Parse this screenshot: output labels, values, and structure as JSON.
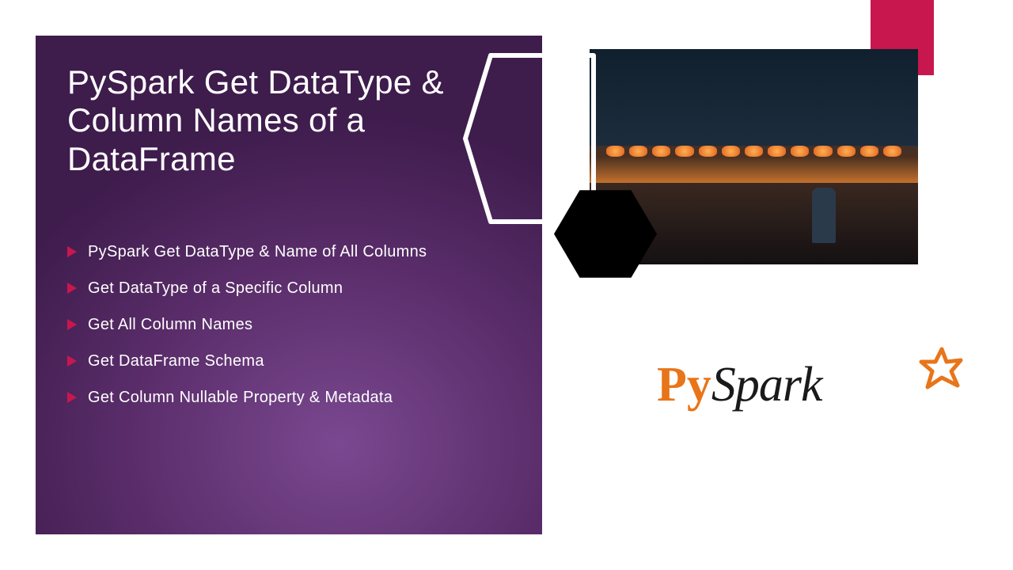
{
  "title": "PySpark Get DataType & Column Names of a DataFrame",
  "bullets": [
    "PySpark Get DataType & Name of All Columns",
    "Get DataType of a Specific Column",
    "Get All Column Names",
    "Get DataFrame Schema",
    "Get Column Nullable Property & Metadata"
  ],
  "logo": {
    "py": "Py",
    "spark": "Spark"
  },
  "colors": {
    "accent_pink": "#c8174e",
    "logo_orange": "#e8751a",
    "panel_purple": "#5a2d6a"
  }
}
